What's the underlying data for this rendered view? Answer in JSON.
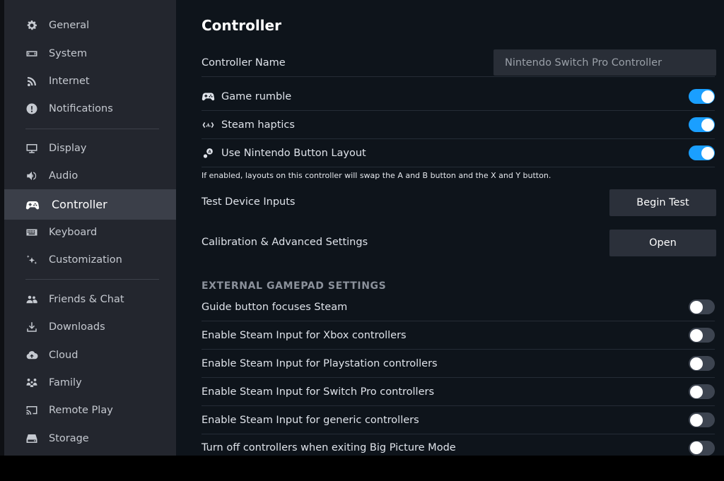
{
  "sidebar": {
    "items": [
      {
        "label": "General",
        "icon": "gear-icon"
      },
      {
        "label": "System",
        "icon": "system-icon"
      },
      {
        "label": "Internet",
        "icon": "wifi-icon"
      },
      {
        "label": "Notifications",
        "icon": "alert-icon"
      },
      {
        "label": "Display",
        "icon": "monitor-icon"
      },
      {
        "label": "Audio",
        "icon": "speaker-icon"
      },
      {
        "label": "Controller",
        "icon": "gamepad-icon",
        "active": true
      },
      {
        "label": "Keyboard",
        "icon": "keyboard-icon"
      },
      {
        "label": "Customization",
        "icon": "sparkle-icon"
      },
      {
        "label": "Friends & Chat",
        "icon": "friends-icon"
      },
      {
        "label": "Downloads",
        "icon": "download-icon"
      },
      {
        "label": "Cloud",
        "icon": "cloud-icon"
      },
      {
        "label": "Family",
        "icon": "family-icon"
      },
      {
        "label": "Remote Play",
        "icon": "cast-icon"
      },
      {
        "label": "Storage",
        "icon": "storage-icon"
      }
    ]
  },
  "main": {
    "title": "Controller",
    "controller_name": {
      "label": "Controller Name",
      "value": "Nintendo Switch Pro Controller"
    },
    "toggles": [
      {
        "label": "Game rumble",
        "icon": "gamepad-icon",
        "on": true
      },
      {
        "label": "Steam haptics",
        "icon": "haptics-icon",
        "on": true
      },
      {
        "label": "Use Nintendo Button Layout",
        "icon": "button-layout-icon",
        "on": true
      }
    ],
    "hint": "If enabled, layouts on this controller will swap the A and B button and the X and Y button.",
    "test_inputs": {
      "label": "Test Device Inputs",
      "button": "Begin Test"
    },
    "calibration": {
      "label": "Calibration & Advanced Settings",
      "button": "Open"
    },
    "external_section": {
      "header": "EXTERNAL GAMEPAD SETTINGS",
      "toggles": [
        {
          "label": "Guide button focuses Steam",
          "on": false
        },
        {
          "label": "Enable Steam Input for Xbox controllers",
          "on": false
        },
        {
          "label": "Enable Steam Input for Playstation controllers",
          "on": false
        },
        {
          "label": "Enable Steam Input for Switch Pro controllers",
          "on": false
        },
        {
          "label": "Enable Steam Input for generic controllers",
          "on": false
        },
        {
          "label": "Turn off controllers when exiting Big Picture Mode",
          "on": false
        }
      ]
    }
  },
  "colors": {
    "accent": "#1a9fff",
    "sidebar_bg": "#23262e",
    "sidebar_active": "#3b3f49",
    "main_bg": "#0e141b"
  }
}
